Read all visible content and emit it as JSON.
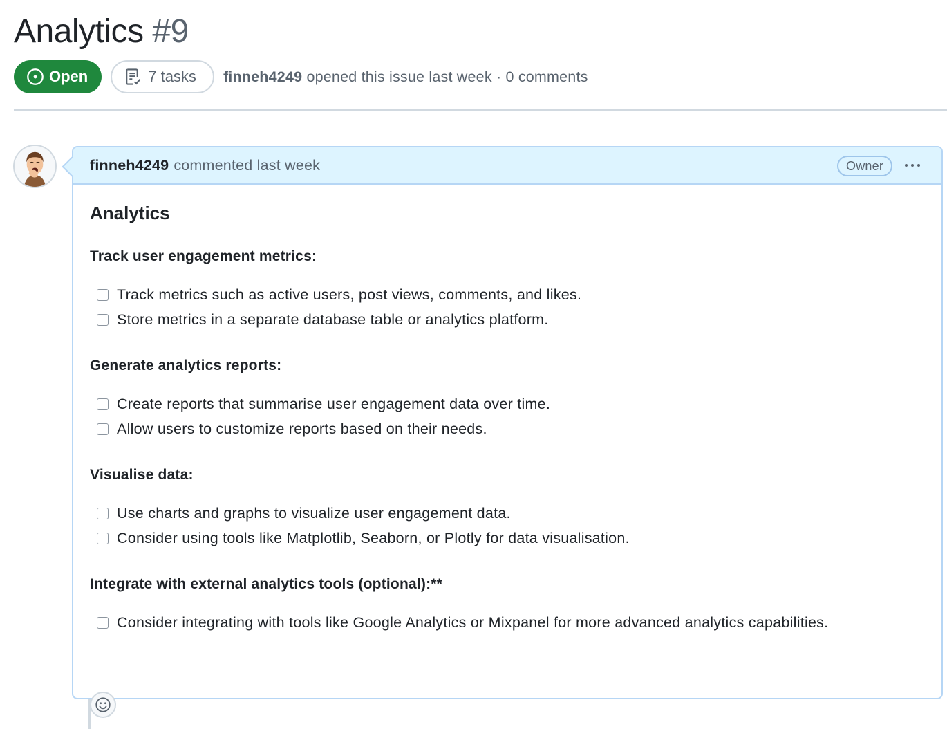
{
  "issue": {
    "title": "Analytics",
    "number": "#9",
    "state": "Open",
    "tasks_label": "7 tasks",
    "author": "finneh4249",
    "meta": "opened this issue last week · 0 comments"
  },
  "comment": {
    "author": "finneh4249",
    "action": "commented last week",
    "role_badge": "Owner",
    "heading": "Analytics",
    "sections": [
      {
        "title": "Track user engagement metrics:",
        "tasks": [
          "Track metrics such as active users, post views, comments, and likes.",
          "Store metrics in a separate database table or analytics platform."
        ]
      },
      {
        "title": "Generate analytics reports:",
        "tasks": [
          "Create reports that summarise user engagement data over time.",
          "Allow users to customize reports based on their needs."
        ]
      },
      {
        "title": "Visualise data:",
        "tasks": [
          "Use charts and graphs to visualize user engagement data.",
          "Consider using tools like Matplotlib, Seaborn, or Plotly for data visualisation."
        ]
      },
      {
        "title": "Integrate with external analytics tools (optional):**",
        "tasks": [
          "Consider integrating with tools like Google Analytics or Mixpanel for more advanced analytics capabilities."
        ]
      }
    ]
  },
  "icons": {
    "state": "issue-opened-icon",
    "tasks": "checklist-icon",
    "menu": "kebab-horizontal-icon",
    "reaction": "smiley-icon"
  },
  "colors": {
    "open_green": "#1f883d",
    "comment_header_bg": "#ddf4ff",
    "comment_border": "#b6d6f5"
  }
}
